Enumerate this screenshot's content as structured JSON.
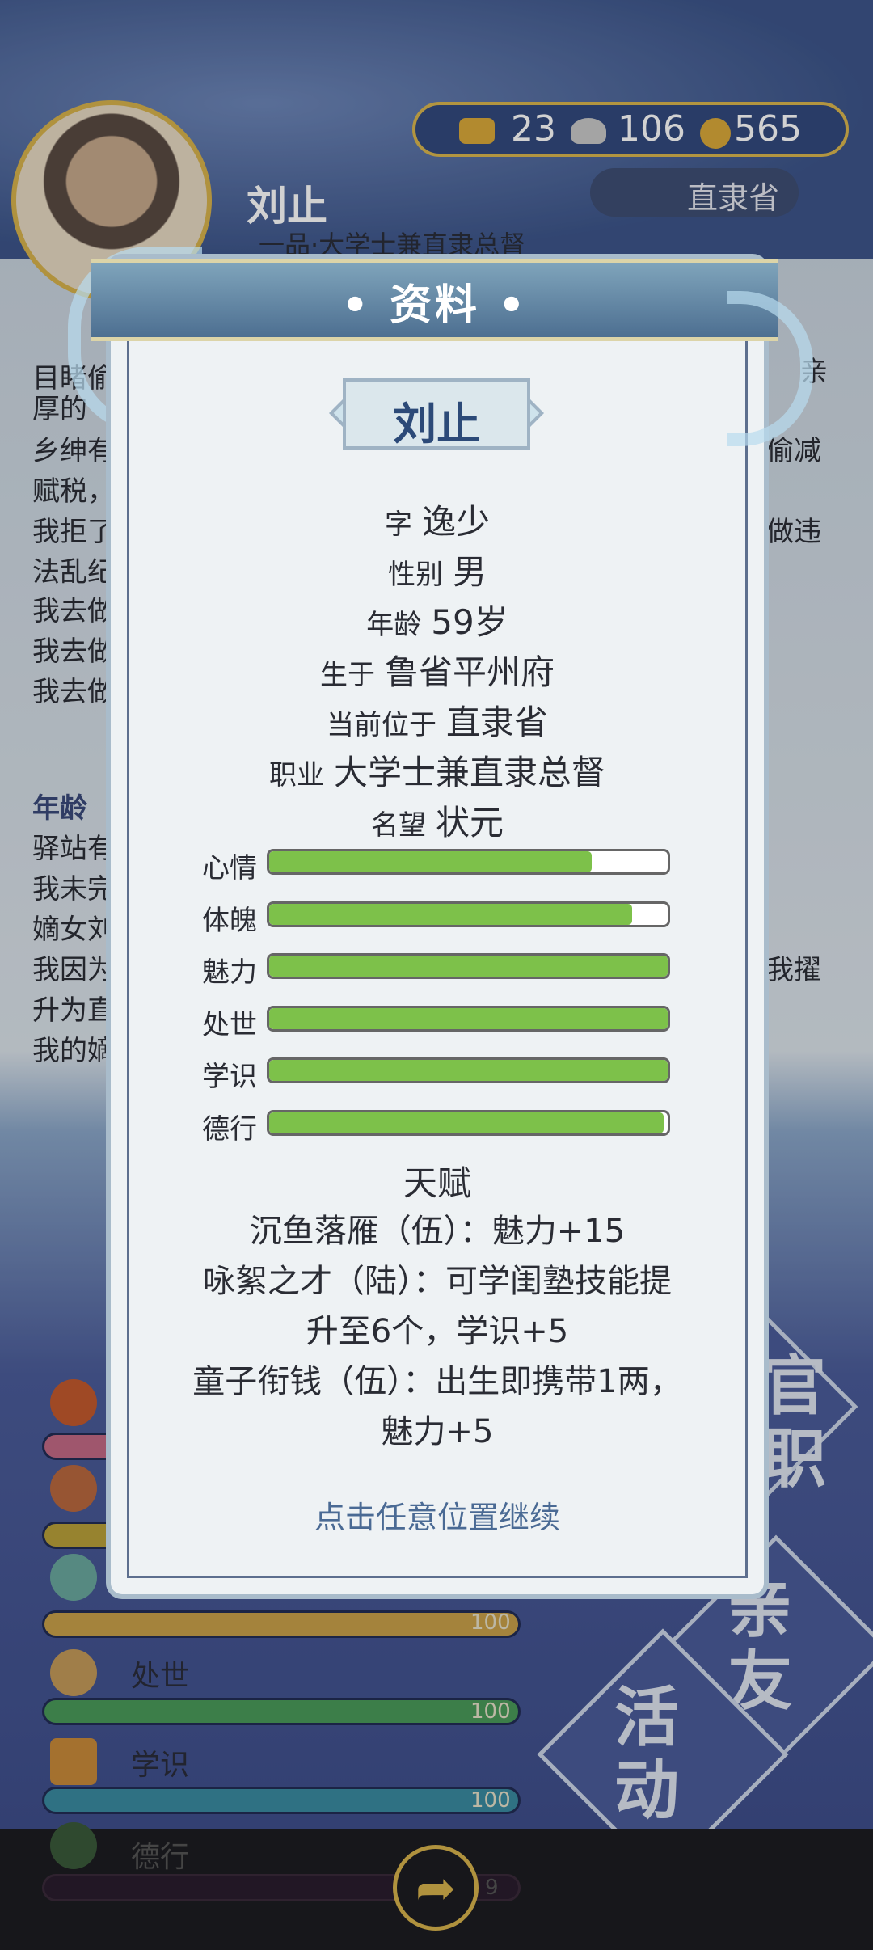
{
  "background": {
    "character_name": "刘止",
    "character_title": "一品·大学士兼直隶总督",
    "resources": {
      "gold": "23",
      "silver": "106",
      "coins": "565"
    },
    "location": "直隶省",
    "log_lines": [
      "目睹偷",
      "厚的",
      "乡绅有",
      "赋税，",
      "我拒了",
      "法乱纪",
      "我去做",
      "我去做",
      "我去做"
    ],
    "log_right": [
      "亲",
      "偷减",
      "做违"
    ],
    "age_header": "年龄 ",
    "log_lines_2": [
      "驿站有",
      "我未完",
      "嫡女刘",
      "我因为",
      "升为直",
      "我的嫡"
    ],
    "log_right_2": [
      "我擢"
    ],
    "attributes": [
      {
        "name": "处世",
        "value": "100"
      },
      {
        "name": "学识",
        "value": "100"
      },
      {
        "name": "德行",
        "value": "9"
      }
    ],
    "attr_value_hidden": "100",
    "side_buttons": [
      "官职",
      "亲友",
      "活动"
    ]
  },
  "modal": {
    "title": "• 资料 •",
    "name": "刘止",
    "info": [
      {
        "key": "字",
        "value": "逸少"
      },
      {
        "key": "性别",
        "value": "男"
      },
      {
        "key": "年龄",
        "value": "59岁"
      },
      {
        "key": "生于",
        "value": "鲁省平州府"
      },
      {
        "key": "当前位于",
        "value": "直隶省"
      },
      {
        "key": "职业",
        "value": "大学士兼直隶总督"
      },
      {
        "key": "名望",
        "value": "状元"
      }
    ],
    "stats": [
      {
        "label": "心情",
        "fill": 0.81
      },
      {
        "label": "体魄",
        "fill": 0.91
      },
      {
        "label": "魅力",
        "fill": 1.0
      },
      {
        "label": "处世",
        "fill": 1.0
      },
      {
        "label": "学识",
        "fill": 1.0
      },
      {
        "label": "德行",
        "fill": 0.99
      }
    ],
    "talent_title": "天赋",
    "talent_lines": [
      "沉鱼落雁（伍）：魅力+15",
      "咏絮之才（陆）：可学闺塾技能提",
      "升至6个，学识+5",
      "童子衔钱（伍）：出生即携带1两，",
      "魅力+5"
    ],
    "continue_text": "点击任意位置继续"
  },
  "share_icon": "share-icon",
  "colors": {
    "bar_fill": "#7dc14a",
    "accent_gold": "#d7b24c",
    "header_blue": "#4d6f91"
  }
}
